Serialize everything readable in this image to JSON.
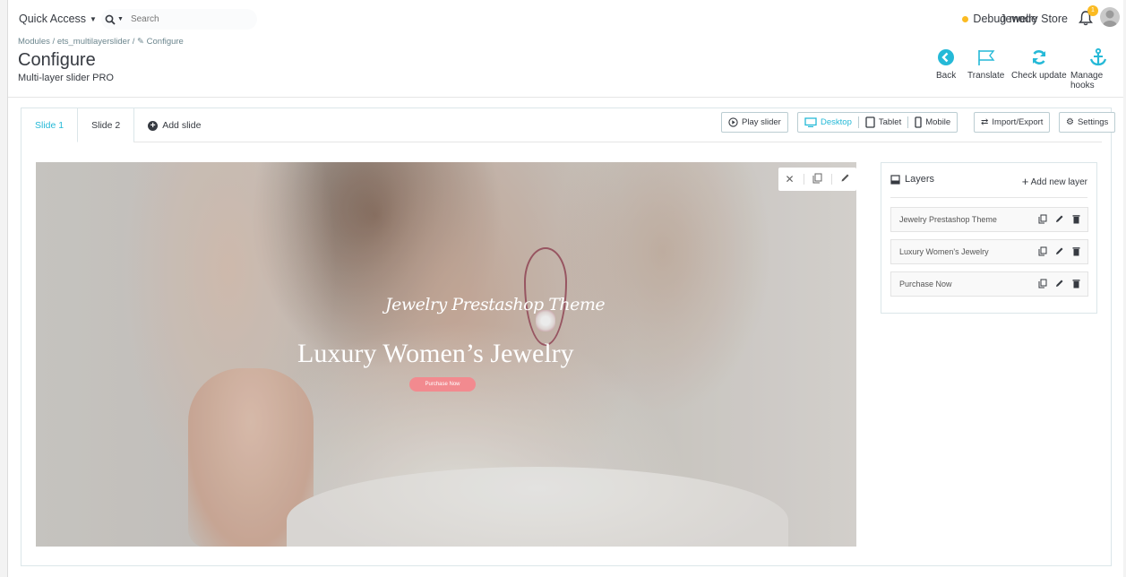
{
  "topbar": {
    "quick_access": "Quick Access",
    "search_placeholder": "Search",
    "debug_mode": "Debug mode",
    "store_name": "Jewelry Store",
    "notification_count": "1"
  },
  "header": {
    "breadcrumb": "Modules / ets_multilayerslider / ✎ Configure",
    "title": "Configure",
    "subtitle": "Multi-layer slider PRO",
    "toolbar": {
      "back": "Back",
      "translate": "Translate",
      "check_update": "Check update",
      "manage_hooks": "Manage hooks"
    }
  },
  "tabs": [
    {
      "label": "Slide 1",
      "active": true
    },
    {
      "label": "Slide 2",
      "active": false
    }
  ],
  "add_slide": "Add slide",
  "actions": {
    "play_slider": "Play slider",
    "desktop": "Desktop",
    "tablet": "Tablet",
    "mobile": "Mobile",
    "import_export": "Import/Export",
    "settings": "Settings"
  },
  "slide": {
    "script_text": "Jewelry Prestashop Theme",
    "headline": "Luxury Women’s Jewelry",
    "button": "Purchase Now"
  },
  "layers_panel": {
    "title": "Layers",
    "add_new": "Add new layer",
    "items": [
      {
        "label": "Jewelry Prestashop Theme"
      },
      {
        "label": "Luxury Women's Jewelry"
      },
      {
        "label": "Purchase Now"
      }
    ]
  },
  "colors": {
    "accent": "#25b9d7",
    "debug_dot": "#fbbb22",
    "cta_button": "#f28a8f"
  },
  "icons": [
    "search-icon",
    "bell-icon",
    "back-icon",
    "flag-icon",
    "refresh-icon",
    "anchor-icon",
    "plus-circle-icon",
    "play-icon",
    "desktop-icon",
    "tablet-icon",
    "mobile-icon",
    "swap-icon",
    "gear-icon",
    "close-icon",
    "copy-icon",
    "pencil-icon",
    "trash-icon",
    "layers-icon"
  ]
}
